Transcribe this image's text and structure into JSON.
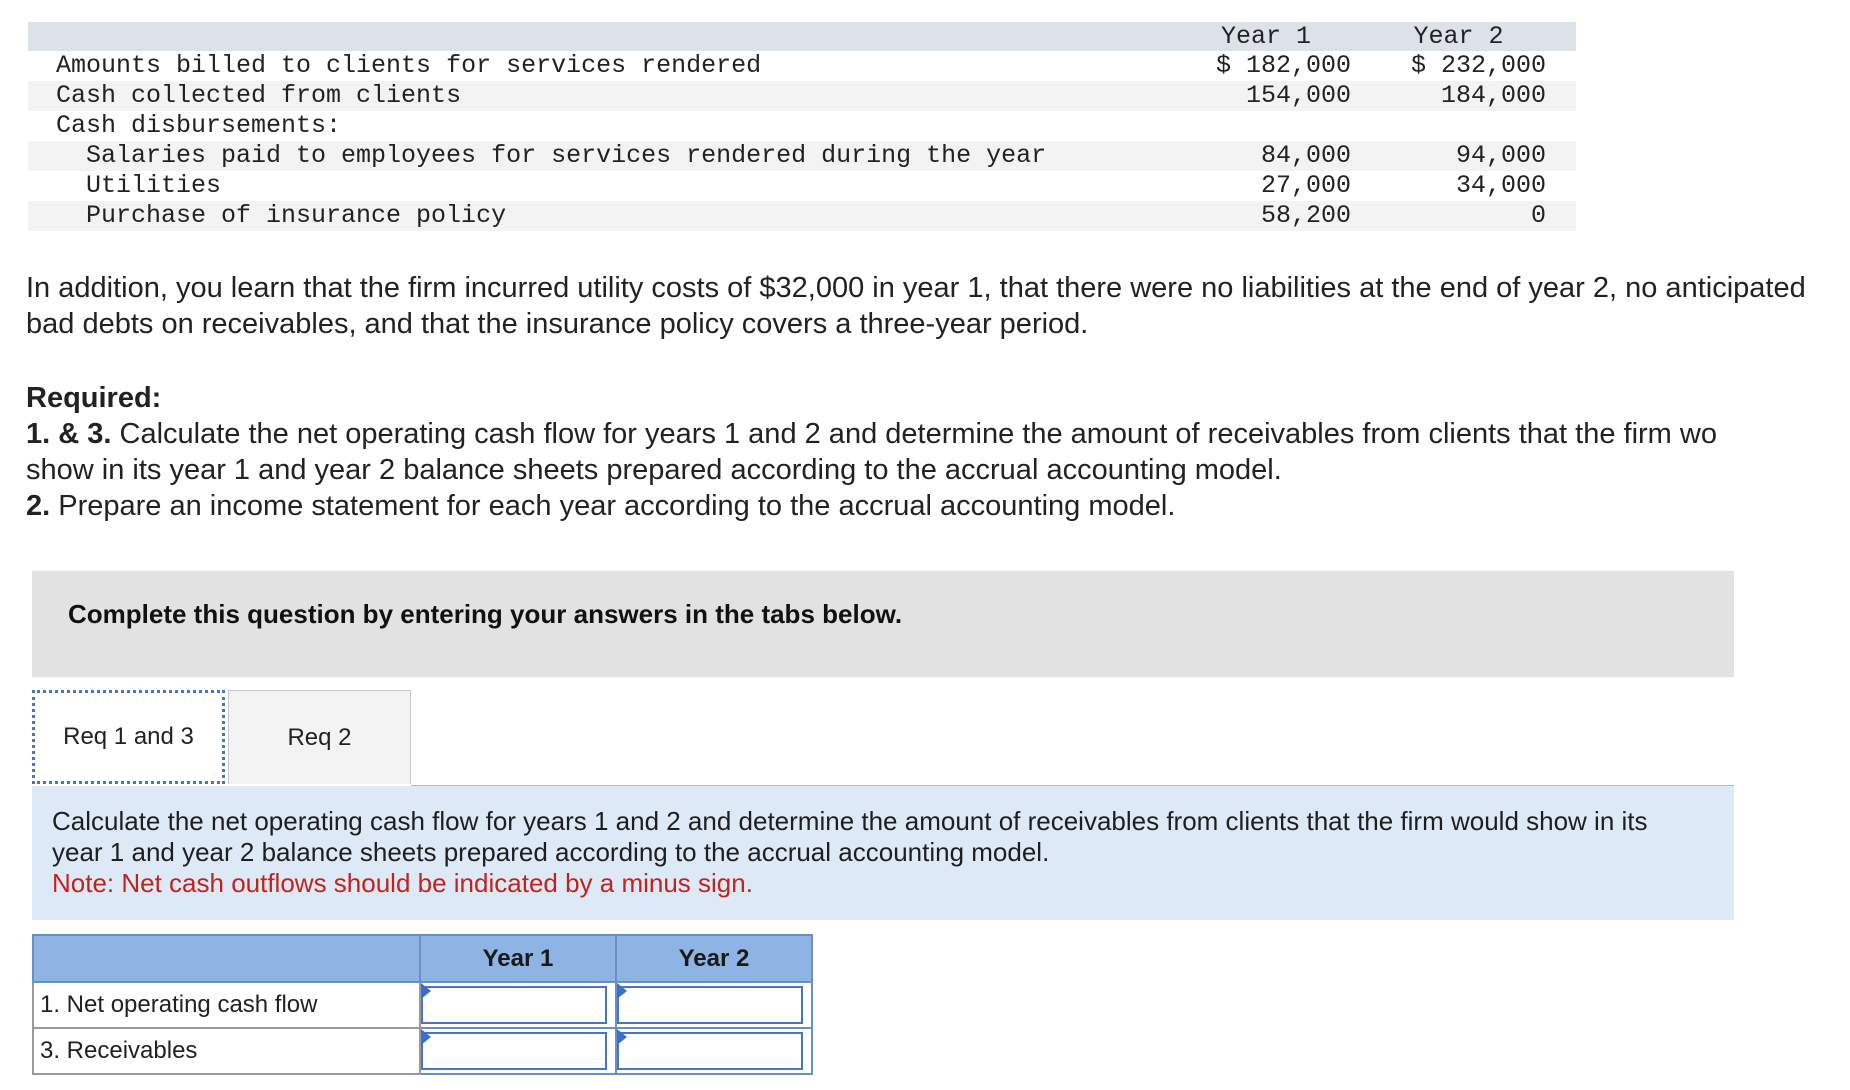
{
  "data_table": {
    "headers": [
      "Year 1",
      "Year 2"
    ],
    "rows": [
      {
        "label": "Amounts billed to clients for services rendered",
        "y1": "$ 182,000",
        "y2": "$ 232,000"
      },
      {
        "label": "Cash collected from clients",
        "y1": "154,000",
        "y2": "184,000"
      },
      {
        "label": "Cash disbursements:",
        "y1": "",
        "y2": ""
      },
      {
        "label": "Salaries paid to employees for services rendered during the year",
        "y1": "84,000",
        "y2": "94,000"
      },
      {
        "label": "Utilities",
        "y1": "27,000",
        "y2": "34,000"
      },
      {
        "label": "Purchase of insurance policy",
        "y1": "58,200",
        "y2": "0"
      }
    ]
  },
  "intro": {
    "text": "In addition, you learn that the firm incurred utility costs of $32,000 in year 1, that there were no liabilities at the end of year 2, no anticipated bad debts on receivables, and that the insurance policy covers a three-year period."
  },
  "required": {
    "heading": "Required:",
    "item1_num": "1. & 3.",
    "item1_text": "Calculate the net operating cash flow for years 1 and 2 and determine the amount of receivables from clients that the firm wo",
    "item1_cont": "show in its year 1 and year 2 balance sheets prepared according to the accrual accounting model.",
    "item2_num": "2.",
    "item2_text": "Prepare an income statement for each year according to the accrual accounting model."
  },
  "instructions": {
    "text": "Complete this question by entering your answers in the tabs below."
  },
  "tabs": [
    {
      "label": "Req 1 and 3"
    },
    {
      "label": "Req 2"
    }
  ],
  "description": {
    "text": "Calculate the net operating cash flow for years 1 and 2 and determine the amount of receivables from clients that the firm would show in its year 1 and year 2 balance sheets prepared according to the accrual accounting model.",
    "note": "Note: Net cash outflows should be indicated by a minus sign."
  },
  "answer_table": {
    "headers": [
      "Year 1",
      "Year 2"
    ],
    "rows": [
      {
        "label": "1. Net operating cash flow",
        "y1": "",
        "y2": ""
      },
      {
        "label": "3. Receivables",
        "y1": "",
        "y2": ""
      }
    ]
  },
  "colors": {
    "header_blue": "#8eb4e3",
    "desc_bg": "#dde9f6",
    "note_red": "#c0241d"
  }
}
